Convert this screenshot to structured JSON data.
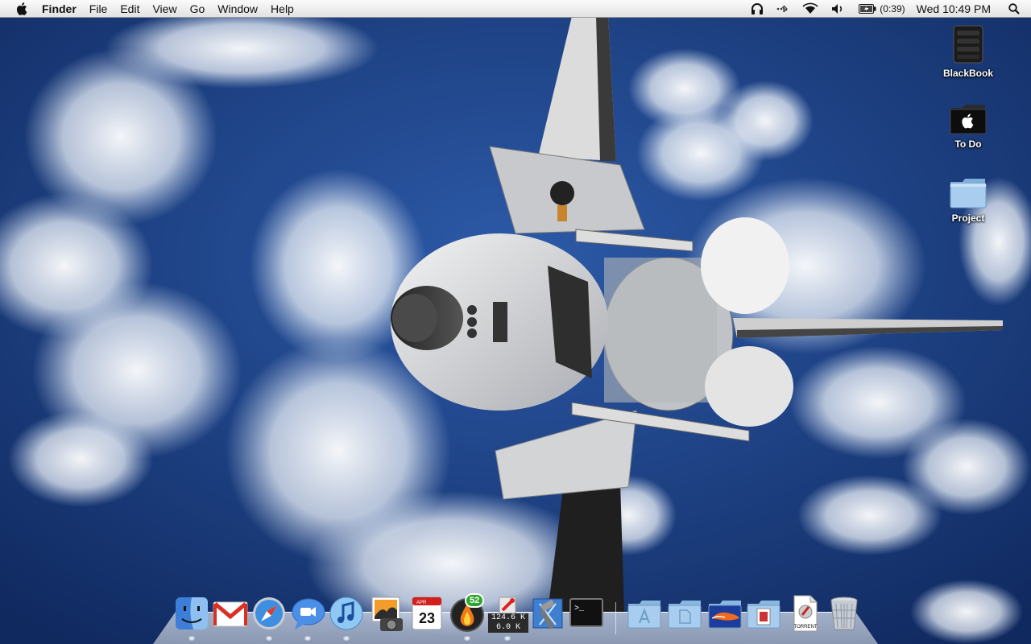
{
  "menubar": {
    "apple_icon": "apple-logo-icon",
    "app_name": "Finder",
    "menus": [
      "File",
      "Edit",
      "View",
      "Go",
      "Window",
      "Help"
    ],
    "status_icons": [
      "headphones-icon",
      "bluetooth-icon",
      "wifi-icon",
      "volume-icon",
      "battery-icon"
    ],
    "battery_time": "(0:39)",
    "clock": "Wed 10:49 PM",
    "spotlight_icon": "spotlight-icon"
  },
  "desktop_icons": [
    {
      "label": "BlackBook",
      "icon": "hard-drive-icon"
    },
    {
      "label": "To Do",
      "icon": "black-apple-folder-icon"
    },
    {
      "label": "Project",
      "icon": "folder-icon"
    }
  ],
  "dock": {
    "apps": [
      {
        "name": "Finder",
        "icon": "finder-icon"
      },
      {
        "name": "Gmail",
        "icon": "gmail-icon"
      },
      {
        "name": "Safari",
        "icon": "safari-icon"
      },
      {
        "name": "iChat",
        "icon": "ichat-icon"
      },
      {
        "name": "iTunes",
        "icon": "itunes-icon"
      },
      {
        "name": "iPhoto",
        "icon": "iphoto-icon"
      },
      {
        "name": "iCal",
        "icon": "ical-icon",
        "month": "APR",
        "day": "23"
      },
      {
        "name": "Torrent client",
        "icon": "torrent-flame-icon",
        "badge": "52"
      },
      {
        "name": "Network meter",
        "icon": "network-meter-icon",
        "up": "124.6 K",
        "down": "6.0 K"
      },
      {
        "name": "Xcode",
        "icon": "xcode-icon"
      },
      {
        "name": "Terminal",
        "icon": "terminal-icon",
        "prompt": ">_"
      }
    ],
    "stacks": [
      {
        "name": "Applications",
        "icon": "applications-stack-icon"
      },
      {
        "name": "Documents",
        "icon": "documents-stack-icon"
      },
      {
        "name": "Florida Gators folder",
        "icon": "gators-folder-icon"
      },
      {
        "name": "Stamp folder",
        "icon": "stamp-folder-icon"
      },
      {
        "name": "Torrent file",
        "icon": "torrent-file-icon",
        "caption": "TORRENT"
      },
      {
        "name": "Trash",
        "icon": "trash-icon"
      }
    ]
  }
}
